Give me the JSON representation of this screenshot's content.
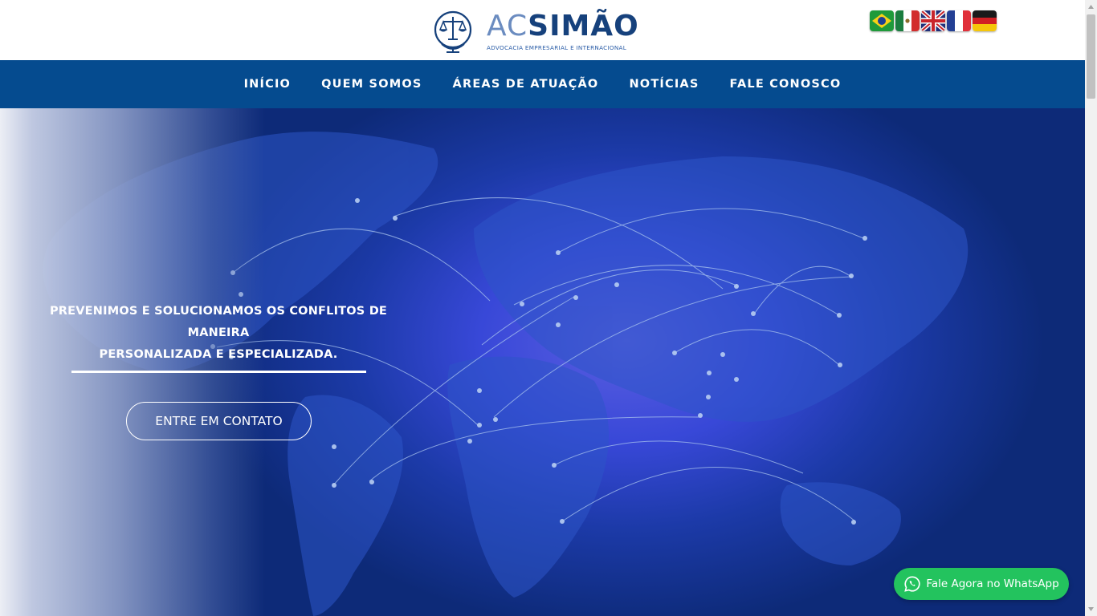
{
  "brand": {
    "name_light": "AC",
    "name_bold": "SIMÃO",
    "tagline": "ADVOCACIA EMPRESARIAL E INTERNACIONAL"
  },
  "languages": [
    {
      "icon": "brazil-flag-icon"
    },
    {
      "icon": "mexico-flag-icon"
    },
    {
      "icon": "uk-flag-icon"
    },
    {
      "icon": "france-flag-icon"
    },
    {
      "icon": "germany-flag-icon"
    }
  ],
  "nav": {
    "items": [
      "INÍCIO",
      "QUEM SOMOS",
      "ÁREAS DE ATUAÇÃO",
      "NOTÍCIAS",
      "FALE CONOSCO"
    ]
  },
  "hero": {
    "headline_line1": "PREVENIMOS E SOLUCIONAMOS OS CONFLITOS DE MANEIRA",
    "headline_line2": "PERSONALIZADA E ESPECIALIZADA.",
    "cta_label": "ENTRE EM CONTATO",
    "background": "world-map-network"
  },
  "whatsapp": {
    "label": "Fale Agora no WhatsApp",
    "icon": "whatsapp-icon"
  },
  "colors": {
    "nav_bg": "#054b8f",
    "brand_dark": "#16417c",
    "brand_light": "#6b8cc0",
    "whatsapp_green": "#23c35e"
  }
}
